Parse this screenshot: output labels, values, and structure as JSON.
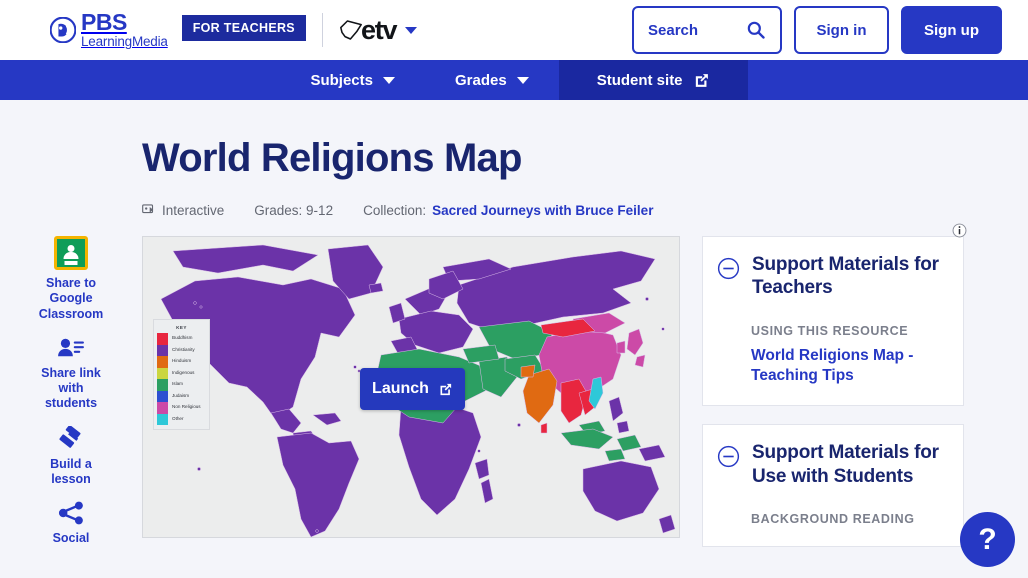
{
  "header": {
    "logo_primary": "PBS",
    "logo_secondary": "LearningMedia",
    "for_teachers_badge": "FOR TEACHERS",
    "station_name": "etv",
    "search_label": "Search",
    "sign_in_label": "Sign in",
    "sign_up_label": "Sign up",
    "accent_color": "#2638c4"
  },
  "nav": {
    "items": [
      {
        "label": "Subjects",
        "has_caret": true,
        "active": false
      },
      {
        "label": "Grades",
        "has_caret": true,
        "active": false
      },
      {
        "label": "Student site",
        "has_caret": false,
        "active": true,
        "external": true
      }
    ],
    "bar_color": "#2638c4",
    "active_color": "#1a28a0"
  },
  "resource": {
    "title": "World Religions Map",
    "type_label": "Interactive",
    "grades_label": "Grades: 9-12",
    "collection_prefix": "Collection:",
    "collection_name": "Sacred Journeys with Bruce Feiler"
  },
  "share_rail": {
    "items": [
      {
        "label": "Share to Google Classroom",
        "icon": "google-classroom-icon"
      },
      {
        "label": "Share link with students",
        "icon": "share-link-icon"
      },
      {
        "label": "Build a lesson",
        "icon": "build-lesson-icon"
      },
      {
        "label": "Social",
        "icon": "social-share-icon"
      }
    ]
  },
  "map": {
    "launch_label": "Launch",
    "key_title": "KEY",
    "background_color": "#eceded",
    "legend": [
      {
        "label": "Buddhism",
        "color": "#e8263f"
      },
      {
        "label": "Christianity",
        "color": "#6b33a8"
      },
      {
        "label": "Hinduism",
        "color": "#e06a12"
      },
      {
        "label": "Indigenous",
        "color": "#cbd640"
      },
      {
        "label": "Islam",
        "color": "#2c9f62"
      },
      {
        "label": "Judaism",
        "color": "#2d4fd1"
      },
      {
        "label": "Non Religious",
        "color": "#cc4aa7"
      },
      {
        "label": "Other",
        "color": "#2ec8d8"
      }
    ]
  },
  "support_panels": [
    {
      "title": "Support Materials for Teachers",
      "section_label": "USING THIS RESOURCE",
      "link_label": "World Religions Map - Teaching Tips"
    },
    {
      "title": "Support Materials for Use with Students",
      "section_label": "BACKGROUND READING",
      "link_label": ""
    }
  ],
  "help": {
    "label": "?"
  }
}
